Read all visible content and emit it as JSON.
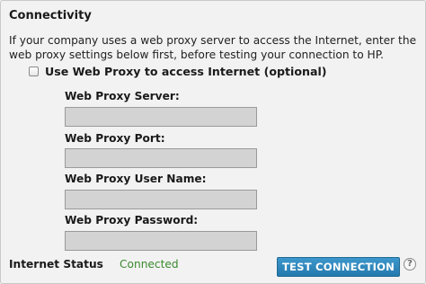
{
  "section": {
    "title": "Connectivity",
    "description": "If your company uses a web proxy server to access the Internet, enter the web proxy settings below first, before testing your connection to HP."
  },
  "proxy_toggle": {
    "label": "Use Web Proxy to access Internet (optional)",
    "checked": false
  },
  "fields": {
    "server": {
      "label": "Web Proxy Server:",
      "value": ""
    },
    "port": {
      "label": "Web Proxy Port:",
      "value": ""
    },
    "username": {
      "label": "Web Proxy User Name:",
      "value": ""
    },
    "password": {
      "label": "Web Proxy Password:",
      "value": ""
    }
  },
  "status": {
    "label": "Internet Status",
    "value": "Connected",
    "value_color": "#3a8a2e"
  },
  "actions": {
    "test_label": "TEST CONNECTION",
    "help_glyph": "?"
  },
  "icons": {
    "help": "help-icon"
  }
}
